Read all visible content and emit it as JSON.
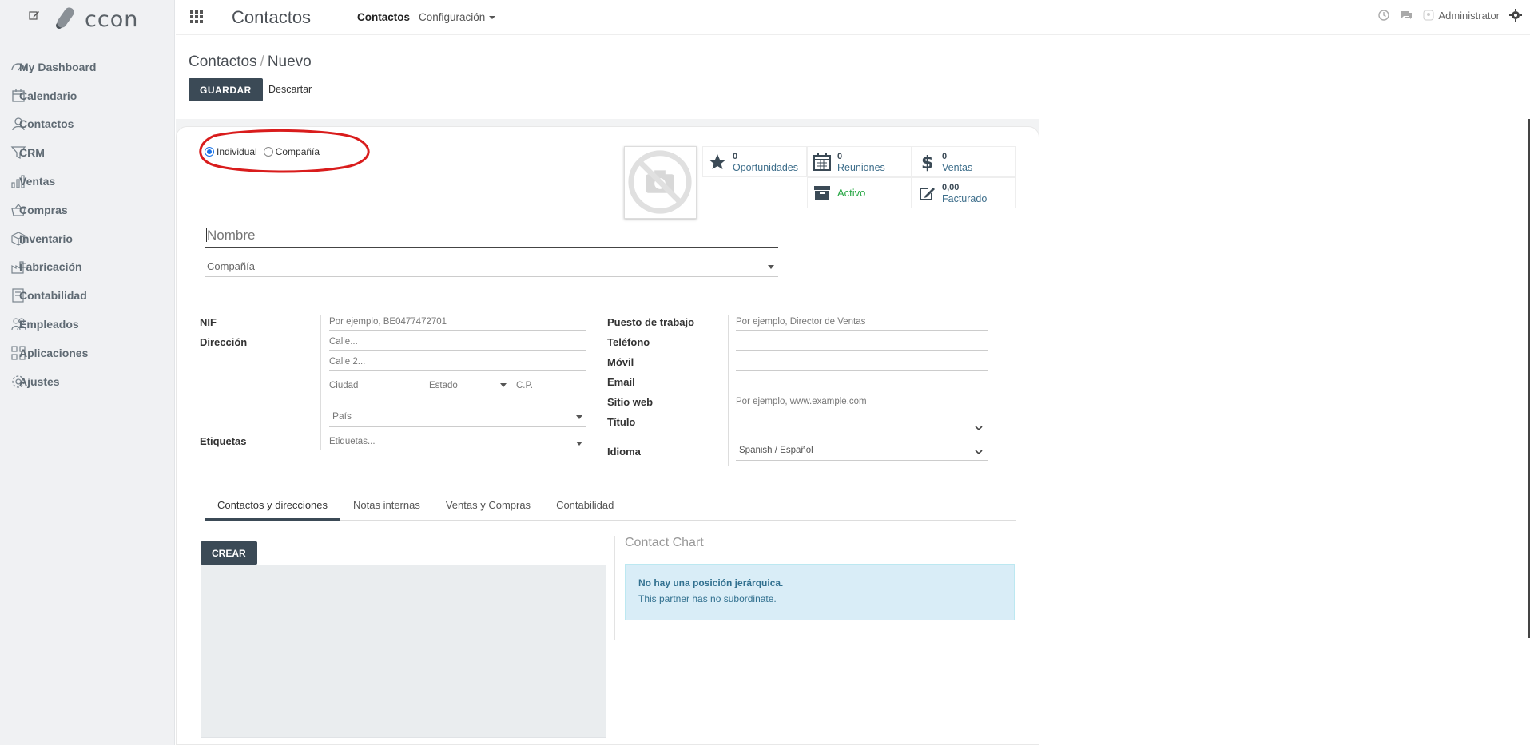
{
  "sidebar": {
    "items": [
      {
        "label": "My Dashboard",
        "icon": "gauge-icon"
      },
      {
        "label": "Calendario",
        "icon": "calendar-icon"
      },
      {
        "label": "Contactos",
        "icon": "user-icon"
      },
      {
        "label": "CRM",
        "icon": "funnel-icon"
      },
      {
        "label": "Ventas",
        "icon": "bar-chart-icon"
      },
      {
        "label": "Compras",
        "icon": "basket-icon"
      },
      {
        "label": "Inventario",
        "icon": "box-icon"
      },
      {
        "label": "Fabricación",
        "icon": "factory-icon"
      },
      {
        "label": "Contabilidad",
        "icon": "ledger-icon"
      },
      {
        "label": "Empleados",
        "icon": "employees-icon"
      },
      {
        "label": "Aplicaciones",
        "icon": "grid-icon"
      },
      {
        "label": "Ajustes",
        "icon": "gear-icon"
      }
    ]
  },
  "topbar": {
    "app_title": "Contactos",
    "menu_contactos": "Contactos",
    "menu_config": "Configuración",
    "user": "Administrator"
  },
  "control": {
    "breadcrumb_parent": "Contactos",
    "breadcrumb_sep": "/",
    "breadcrumb_current": "Nuevo",
    "save_label": "GUARDAR",
    "discard_label": "Descartar"
  },
  "form": {
    "type_individual": "Individual",
    "type_company": "Compañía",
    "name_placeholder": "Nombre",
    "company_placeholder": "Compañía",
    "stats": {
      "opportunities_count": "0",
      "opportunities_label": "Oportunidades",
      "meetings_count": "0",
      "meetings_label": "Reuniones",
      "sales_count": "0",
      "sales_label": "Ventas",
      "active_label": "Activo",
      "invoiced_amount": "0,00",
      "invoiced_label": "Facturado"
    },
    "left": {
      "nif_label": "NIF",
      "nif_placeholder": "Por ejemplo, BE0477472701",
      "address_label": "Dirección",
      "street_placeholder": "Calle...",
      "street2_placeholder": "Calle 2...",
      "city_placeholder": "Ciudad",
      "state_placeholder": "Estado",
      "zip_placeholder": "C.P.",
      "country_placeholder": "País",
      "tags_label": "Etiquetas",
      "tags_placeholder": "Etiquetas..."
    },
    "right": {
      "job_label": "Puesto de trabajo",
      "job_placeholder": "Por ejemplo, Director de Ventas",
      "phone_label": "Teléfono",
      "mobile_label": "Móvil",
      "email_label": "Email",
      "website_label": "Sitio web",
      "website_placeholder": "Por ejemplo, www.example.com",
      "title_label": "Título",
      "lang_label": "Idioma",
      "lang_value": "Spanish / Español"
    },
    "tabs": [
      "Contactos y direcciones",
      "Notas internas",
      "Ventas y Compras",
      "Contabilidad"
    ],
    "create_label": "CREAR",
    "chart_title": "Contact Chart",
    "info_title": "No hay una posición jerárquica.",
    "info_text": "This partner has no subordinate."
  }
}
